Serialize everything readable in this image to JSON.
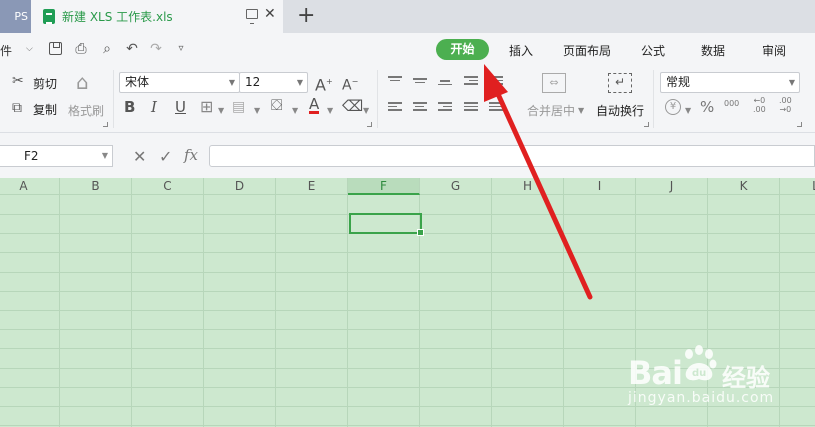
{
  "app_tab": {
    "label": "PS"
  },
  "document_tab": {
    "title": "新建 XLS 工作表.xls",
    "close": "✕"
  },
  "new_tab": {
    "label": "+"
  },
  "menu": {
    "file_label": "文件",
    "tabs": [
      {
        "label": "开始",
        "active": true
      },
      {
        "label": "插入"
      },
      {
        "label": "页面布局"
      },
      {
        "label": "公式"
      },
      {
        "label": "数据"
      },
      {
        "label": "审阅"
      }
    ]
  },
  "ribbon": {
    "cut": "剪切",
    "copy": "复制",
    "format_painter": "格式刷",
    "font_name": "宋体",
    "font_size": "12",
    "bold": "B",
    "italic": "I",
    "underline": "U",
    "font_color_glyph": "A",
    "merge_center": "合并居中",
    "wrap_text": "自动换行",
    "number_format": "常规",
    "percent": "%",
    "thousands": "000",
    "inc_decimal": "+.0\n.00",
    "dec_decimal": ".00\n+.0"
  },
  "formula_bar": {
    "cell_ref": "F2",
    "fx": "fx",
    "cancel": "✕",
    "confirm": "✓"
  },
  "grid": {
    "columns": [
      "A",
      "B",
      "C",
      "D",
      "E",
      "F",
      "G",
      "H",
      "I",
      "J",
      "K",
      "L"
    ],
    "active_column": "F",
    "active_cell": "F2"
  },
  "watermark": {
    "brand": "Bai",
    "product": "经验",
    "url": "jingyan.baidu.com"
  },
  "colors": {
    "accent": "#4caf50",
    "grid_bg": "#cde8cf",
    "annotation": "#e02020"
  }
}
